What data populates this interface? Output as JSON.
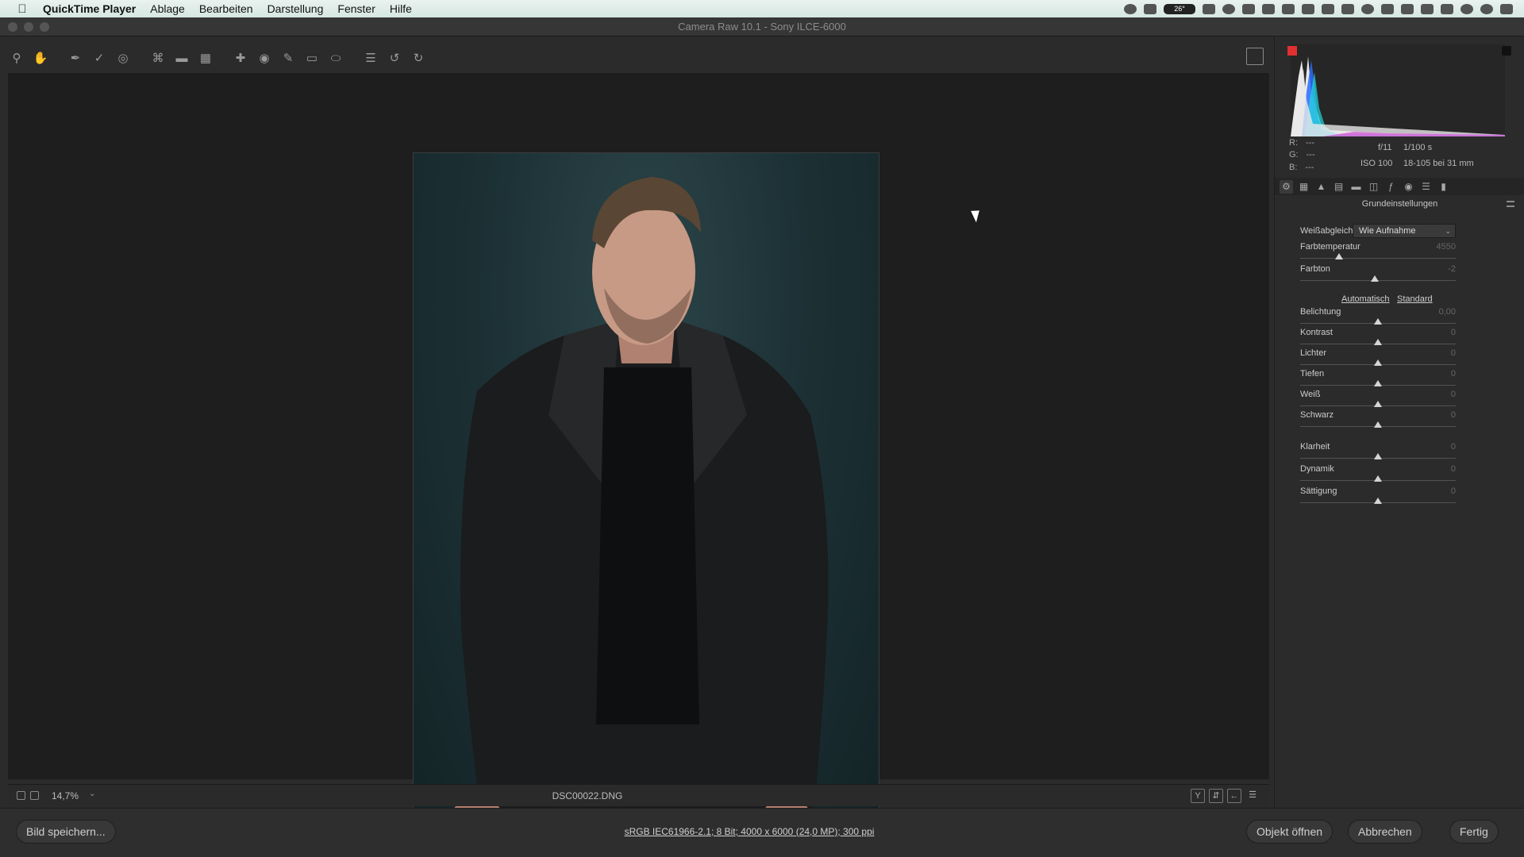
{
  "menubar": {
    "app_name": "QuickTime Player",
    "items": [
      "Ablage",
      "Bearbeiten",
      "Darstellung",
      "Fenster",
      "Hilfe"
    ],
    "status_badge": "26°"
  },
  "window": {
    "title": "Camera Raw 10.1 - Sony ILCE-6000"
  },
  "toolbar": {
    "tools": [
      "zoom-tool-icon",
      "hand-tool-icon",
      "white-balance-tool-icon",
      "color-sampler-tool-icon",
      "targeted-adjustment-tool-icon",
      "crop-tool-icon",
      "straighten-tool-icon",
      "transform-tool-icon",
      "spot-removal-tool-icon",
      "red-eye-tool-icon",
      "adjustment-brush-icon",
      "graduated-filter-icon",
      "radial-filter-icon",
      "preferences-icon",
      "rotate-left-icon",
      "rotate-right-icon"
    ]
  },
  "canvas": {
    "zoom_value": "14,7%",
    "filename": "DSC00022.DNG"
  },
  "footer": {
    "save_button": "Bild speichern...",
    "workflow_options": "sRGB IEC61966-2.1; 8 Bit; 4000 x 6000 (24,0 MP); 300 ppi",
    "open_object_button": "Objekt öffnen",
    "cancel_button": "Abbrechen",
    "done_button": "Fertig"
  },
  "panel": {
    "rgb": {
      "r_label": "R:",
      "g_label": "G:",
      "b_label": "B:",
      "r": "---",
      "g": "---",
      "b": "---"
    },
    "camera_info": {
      "aperture": "f/11",
      "shutter": "1/100 s",
      "iso": "ISO 100",
      "lens": "18-105 bei 31 mm"
    },
    "section_title": "Grundeinstellungen",
    "white_balance_label": "Weißabgleich:",
    "white_balance_value": "Wie Aufnahme",
    "auto_link": "Automatisch",
    "default_link": "Standard",
    "sliders": [
      {
        "label": "Farbtemperatur",
        "value": "4550",
        "position": 0.25
      },
      {
        "label": "Farbton",
        "value": "-2",
        "position": 0.48
      },
      {
        "label": "Belichtung",
        "value": "0,00",
        "position": 0.5
      },
      {
        "label": "Kontrast",
        "value": "0",
        "position": 0.5
      },
      {
        "label": "Lichter",
        "value": "0",
        "position": 0.5
      },
      {
        "label": "Tiefen",
        "value": "0",
        "position": 0.5
      },
      {
        "label": "Weiß",
        "value": "0",
        "position": 0.5
      },
      {
        "label": "Schwarz",
        "value": "0",
        "position": 0.5
      },
      {
        "label": "Klarheit",
        "value": "0",
        "position": 0.5
      },
      {
        "label": "Dynamik",
        "value": "0",
        "position": 0.5
      },
      {
        "label": "Sättigung",
        "value": "0",
        "position": 0.5
      }
    ]
  }
}
